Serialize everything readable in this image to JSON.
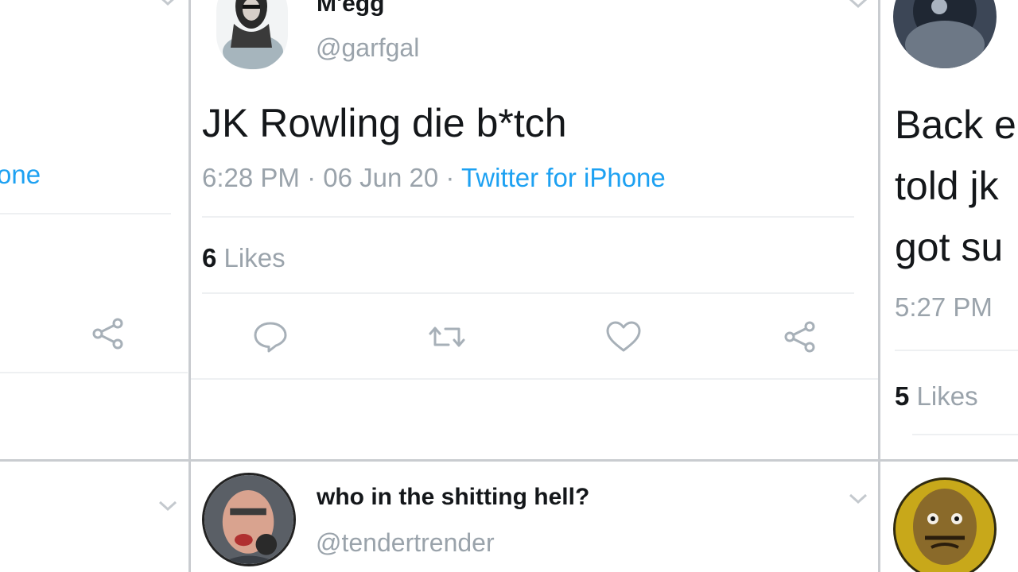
{
  "left_column": {
    "source_fragment": "one"
  },
  "center_tweet": {
    "name": "M'egg",
    "handle": "@garfgal",
    "text": "JK Rowling die b*tch",
    "time": "6:28 PM",
    "date": "06 Jun 20",
    "source": "Twitter for iPhone",
    "separator": "·",
    "likes_count": "6",
    "likes_label": "Likes"
  },
  "right_tweet": {
    "text_lines": [
      "Back e",
      "told jk",
      "got su"
    ],
    "time": "5:27 PM",
    "likes_count": "5",
    "likes_label": "Likes"
  },
  "second_row_tweet": {
    "name": "who in the shitting hell?",
    "handle": "@tendertrender"
  },
  "icons": {
    "reply": "reply-icon",
    "retweet": "retweet-icon",
    "like": "heart-icon",
    "share": "share-icon",
    "more": "chevron-down-icon"
  },
  "colors": {
    "link": "#1da1f2",
    "muted": "#9aa3ab",
    "text": "#14171a",
    "divider": "#c9ccd0"
  }
}
